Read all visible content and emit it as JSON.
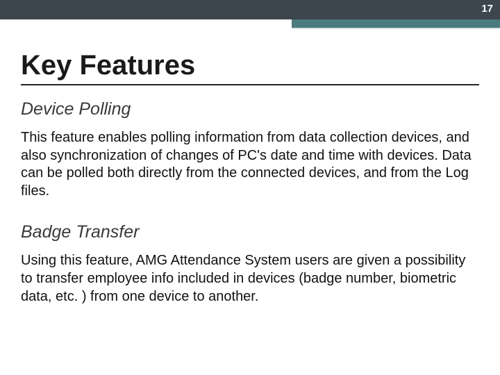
{
  "page_number": "17",
  "title": "Key Features",
  "sections": [
    {
      "heading": "Device Polling",
      "body": "This feature enables polling information from data collection devices, and also synchronization of changes of PC's date and time with devices. Data can be polled both directly from the connected devices, and from the Log files."
    },
    {
      "heading": "Badge Transfer",
      "body": "Using this feature, AMG Attendance System users are given a possibility to transfer employee info included in devices (badge number, biometric data, etc. ) from one device to another."
    }
  ]
}
